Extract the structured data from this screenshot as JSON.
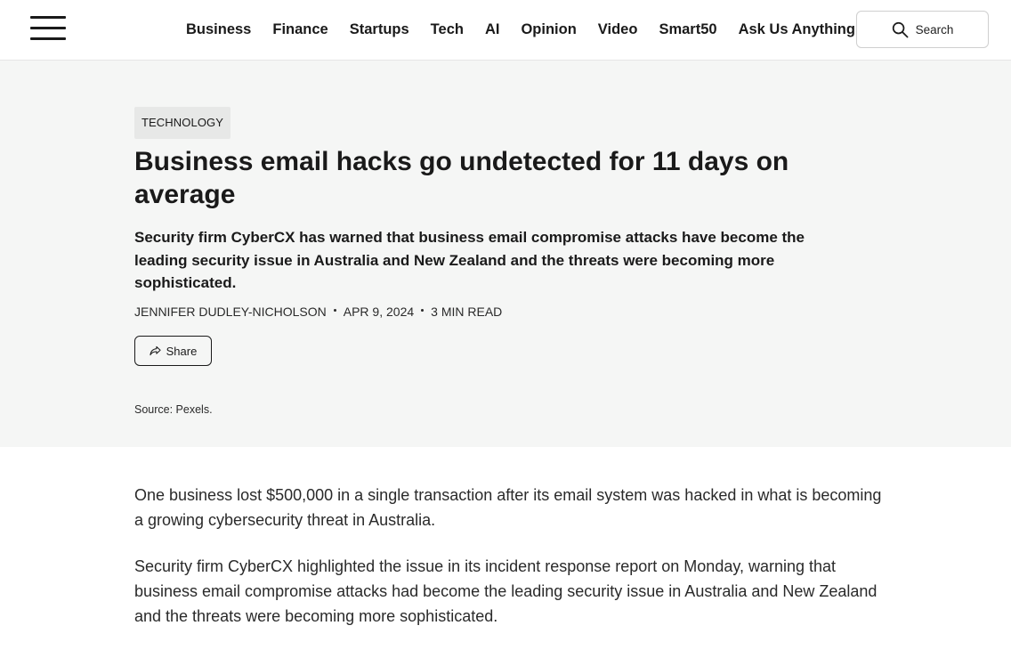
{
  "header": {
    "menu_icon": "hamburger-menu-icon",
    "nav": [
      {
        "label": "Business"
      },
      {
        "label": "Finance"
      },
      {
        "label": "Startups"
      },
      {
        "label": "Tech"
      },
      {
        "label": "AI"
      },
      {
        "label": "Opinion"
      },
      {
        "label": "Video"
      },
      {
        "label": "Smart50"
      },
      {
        "label": "Ask Us Anything"
      }
    ],
    "search": {
      "label": "Search",
      "icon": "search-icon"
    }
  },
  "article": {
    "category": "TECHNOLOGY",
    "headline": "Business email hacks go undetected for 11 days on average",
    "standfirst": "Security firm CyberCX has warned that business email compromise attacks have become the leading security issue in Australia and New Zealand and the threats were becoming more sophisticated.",
    "author": "JENNIFER DUDLEY-NICHOLSON",
    "date": "APR 9, 2024",
    "read_time": "3 MIN READ",
    "share_label": "Share",
    "share_icon": "share-arrow-icon",
    "image_source": "Source: Pexels.",
    "paragraphs": [
      "One business lost $500,000 in a single transaction after its email system was hacked in what is becoming a growing cybersecurity threat in Australia.",
      "Security firm CyberCX highlighted the issue in its incident response report on Monday, warning that business email compromise attacks had become the leading security issue in Australia and New Zealand and the threats were becoming more sophisticated."
    ]
  },
  "colors": {
    "hero_background": "#f5f6f5",
    "category_background": "#e7e8e7",
    "text": "#1a1a1a"
  }
}
